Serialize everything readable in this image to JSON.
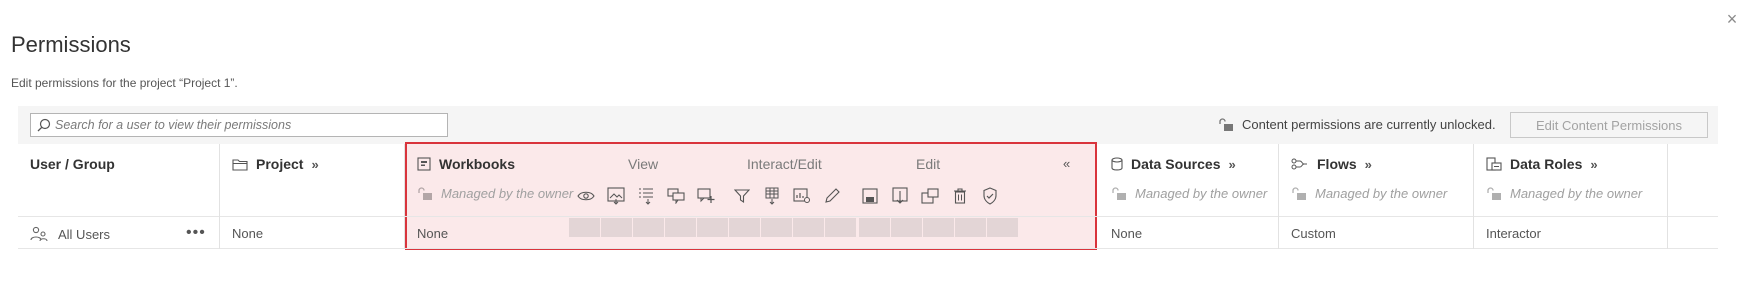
{
  "dialog": {
    "title": "Permissions",
    "subtitle": "Edit permissions for the project “Project 1”.",
    "close_label": "×"
  },
  "toolbar": {
    "search_placeholder": "Search for a user to view their permissions",
    "lock_status": "Content permissions are currently unlocked.",
    "edit_button": "Edit Content Permissions"
  },
  "columns": {
    "user_group": "User / Group",
    "project": "Project",
    "workbooks": "Workbooks",
    "data_sources": "Data Sources",
    "flows": "Flows",
    "data_roles": "Data Roles",
    "expand_glyph": "»",
    "collapse_glyph": "«"
  },
  "workbook_groups": {
    "view": "View",
    "interact_edit": "Interact/Edit",
    "edit": "Edit"
  },
  "managed_text": "Managed by the owner",
  "row": {
    "user": "All Users",
    "more": "•••",
    "project": "None",
    "workbooks": "None",
    "data_sources": "None",
    "flows": "Custom",
    "data_roles": "Interactor"
  },
  "colors": {
    "highlight_border": "#d9343c",
    "highlight_fill": "#fbe9ea",
    "capability_cell": "#e3d5d6"
  },
  "icons": {
    "view": [
      "view-icon",
      "download-image-icon",
      "download-summary-data-icon",
      "view-comments-icon",
      "add-comment-icon"
    ],
    "interact_edit": [
      "filter-icon",
      "download-full-data-icon",
      "share-customized-icon",
      "web-edit-icon"
    ],
    "edit": [
      "save-icon",
      "download-workbook-icon",
      "move-icon",
      "delete-icon",
      "set-permissions-icon"
    ]
  }
}
